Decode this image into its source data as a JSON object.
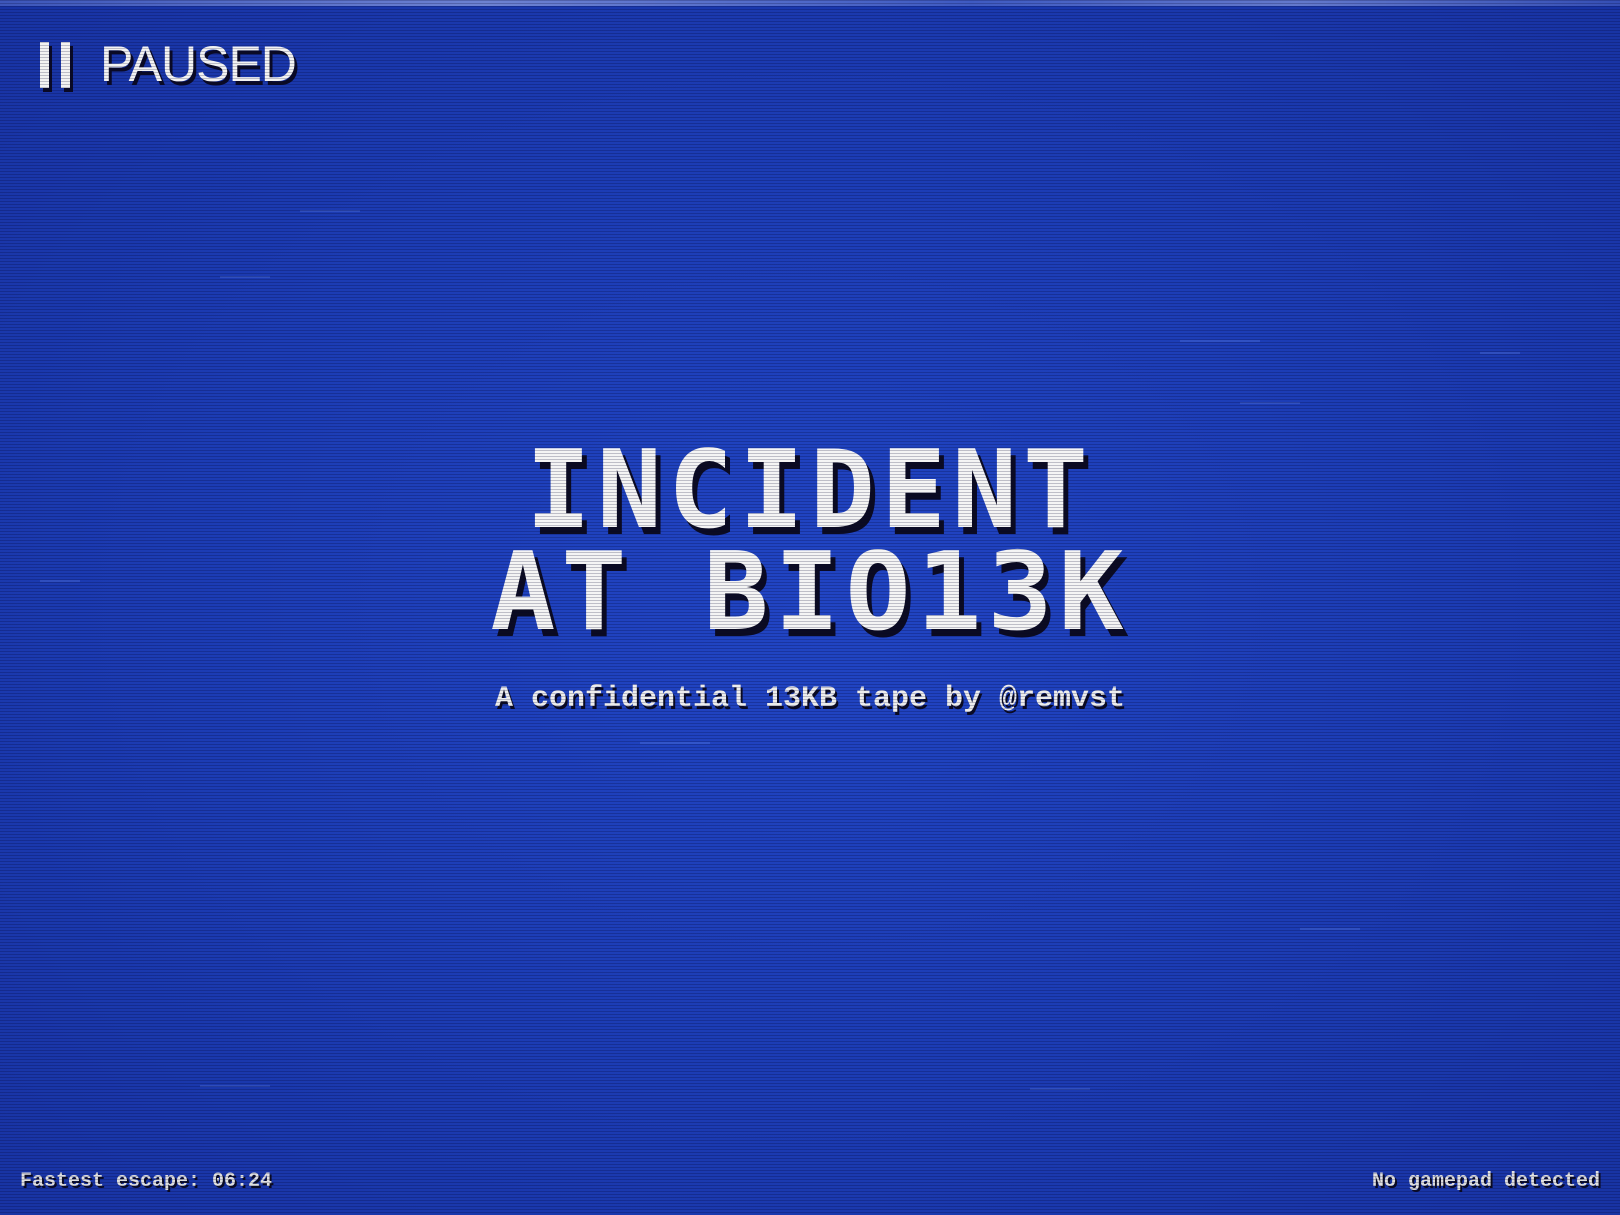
{
  "status": {
    "pause_icon": "pause-icon",
    "label": "PAUSED"
  },
  "title": {
    "line1": "INCIDENT",
    "line2": "AT BIO13K",
    "subtitle": "A confidential 13KB tape by @remvst"
  },
  "footer": {
    "fastest_escape": "Fastest escape: 06:24",
    "gamepad_status": "No gamepad detected"
  },
  "colors": {
    "background": "#1c3cb4",
    "text": "#f4f4f4",
    "shadow": "#0b0b22"
  }
}
